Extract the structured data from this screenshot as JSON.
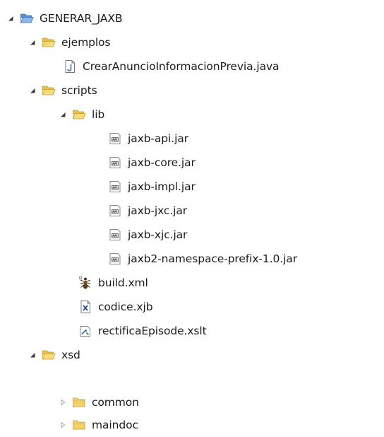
{
  "tree": {
    "root": {
      "label": "GENERAR_JAXB",
      "icon": "project-folder-icon",
      "expanded": true
    },
    "ejemplos": {
      "label": "ejemplos",
      "icon": "folder-open-icon",
      "expanded": true
    },
    "crear_anuncio": {
      "label": "CrearAnuncioInformacionPrevia.java",
      "icon": "java-file-icon"
    },
    "scripts": {
      "label": "scripts",
      "icon": "folder-open-icon",
      "expanded": true
    },
    "lib": {
      "label": "lib",
      "icon": "folder-open-icon",
      "expanded": true
    },
    "jaxb_api": {
      "label": "jaxb-api.jar",
      "icon": "jar-file-icon"
    },
    "jaxb_core": {
      "label": "jaxb-core.jar",
      "icon": "jar-file-icon"
    },
    "jaxb_impl": {
      "label": "jaxb-impl.jar",
      "icon": "jar-file-icon"
    },
    "jaxb_jxc": {
      "label": "jaxb-jxc.jar",
      "icon": "jar-file-icon"
    },
    "jaxb_xjc": {
      "label": "jaxb-xjc.jar",
      "icon": "jar-file-icon"
    },
    "jaxb2_ns": {
      "label": "jaxb2-namespace-prefix-1.0.jar",
      "icon": "jar-file-icon"
    },
    "build_xml": {
      "label": "build.xml",
      "icon": "ant-file-icon"
    },
    "codice_xjb": {
      "label": "codice.xjb",
      "icon": "xml-file-icon"
    },
    "rectifica": {
      "label": "rectificaEpisode.xslt",
      "icon": "xslt-file-icon"
    },
    "xsd": {
      "label": "xsd",
      "icon": "folder-open-icon",
      "expanded": true
    },
    "common": {
      "label": "common",
      "icon": "folder-closed-icon",
      "expanded": false
    },
    "maindoc": {
      "label": "maindoc",
      "icon": "folder-closed-icon",
      "expanded": false
    }
  },
  "colors": {
    "expanded_arrow": "#3c3c3c",
    "collapsed_arrow": "#a5a5a5",
    "folder_body": "#f2d26a",
    "folder_edge": "#c49a2c",
    "project_folder": "#6d9fd8"
  }
}
